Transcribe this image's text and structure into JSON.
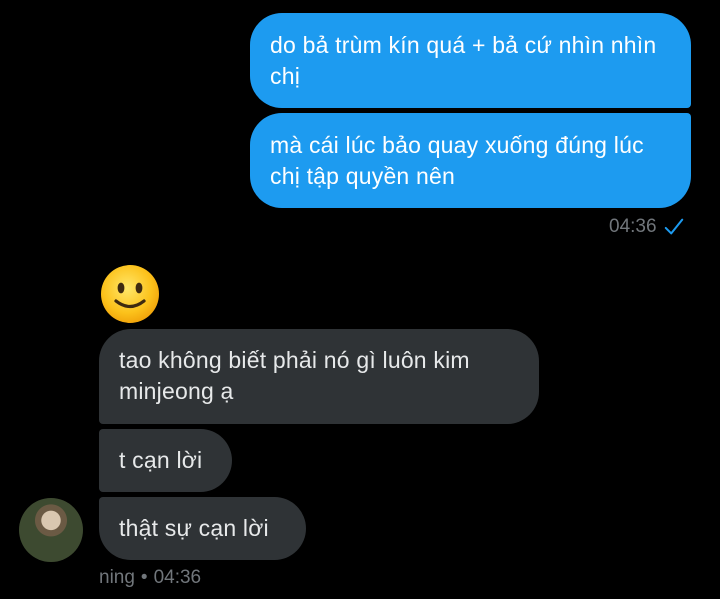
{
  "messages_out": [
    {
      "text": "do bả trùm kín quá + bả cứ nhìn nhìn chị"
    },
    {
      "text": "mà cái lúc bảo quay xuống đúng lúc chị tập quyền nên"
    }
  ],
  "out_meta": {
    "time": "04:36",
    "status_icon": "checkmark-icon"
  },
  "emoji": "🙂",
  "messages_in": [
    {
      "text": "tao không biết phải nó gì luôn kim minjeong ạ"
    },
    {
      "text": "t cạn lời"
    },
    {
      "text": "thật sự cạn lời"
    }
  ],
  "in_meta": {
    "sender": "ning",
    "separator": "•",
    "time": "04:36"
  },
  "colors": {
    "outgoing": "#1d9bf0",
    "incoming": "#2f3336",
    "meta": "#71767b",
    "background": "#000000"
  }
}
